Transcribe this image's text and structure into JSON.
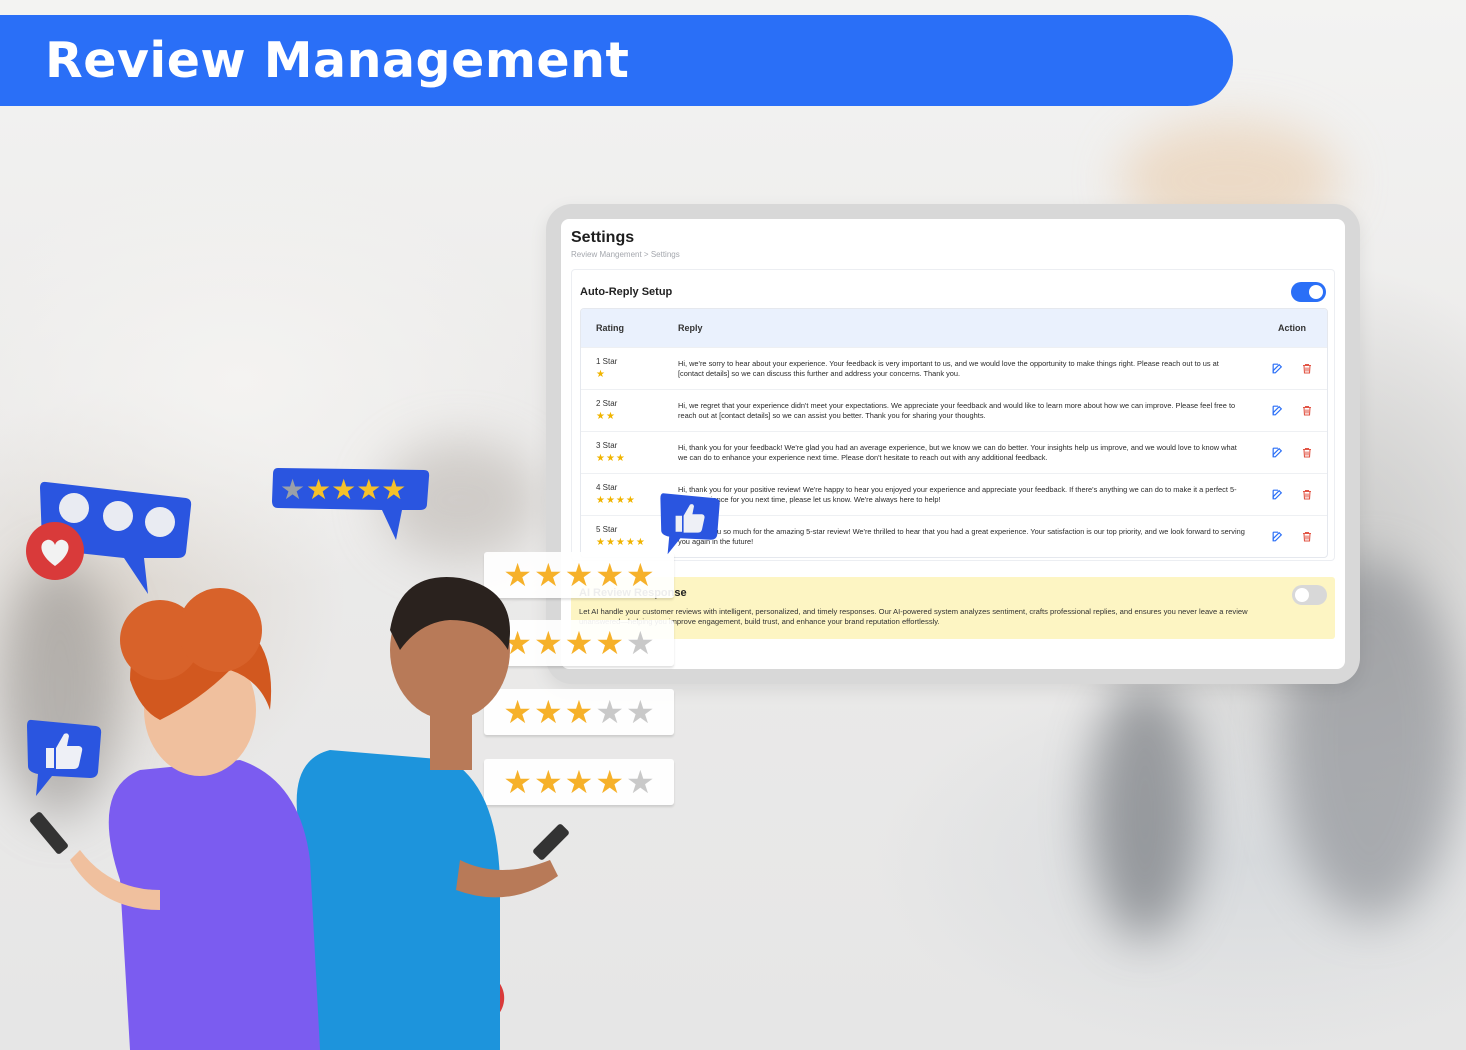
{
  "banner": {
    "title": "Review Management"
  },
  "settings": {
    "title": "Settings",
    "breadcrumb": "Review Mangement > Settings"
  },
  "auto_reply": {
    "title": "Auto-Reply Setup",
    "enabled": true,
    "columns": {
      "rating": "Rating",
      "reply": "Reply",
      "action": "Action"
    },
    "rows": [
      {
        "rating_label": "1 Star",
        "stars": "★",
        "reply": "Hi, we're sorry to hear about your experience. Your feedback is very important to us, and we would love the opportunity to make things right. Please reach out to us at [contact details] so we can discuss this further and address your concerns. Thank you."
      },
      {
        "rating_label": "2 Star",
        "stars": "★★",
        "reply": "Hi, we regret that your experience didn't meet your expectations. We appreciate your feedback and would like to learn more about how we can improve. Please feel free to reach out at [contact details] so we can assist you better. Thank you for sharing your thoughts."
      },
      {
        "rating_label": "3 Star",
        "stars": "★★★",
        "reply": "Hi, thank you for your feedback! We're glad you had an average experience, but we know we can do better. Your insights help us improve, and we would love to know what we can do to enhance your experience next time. Please don't hesitate to reach out with any additional feedback."
      },
      {
        "rating_label": "4 Star",
        "stars": "★★★★",
        "reply": "Hi, thank you for your positive review! We're happy to hear you enjoyed your experience and appreciate your feedback. If there's anything we can do to make it a perfect 5-star experience for you next time, please let us know. We're always here to help!"
      },
      {
        "rating_label": "5 Star",
        "stars": "★★★★★",
        "reply": "Hi, thank you so much for the amazing 5-star review! We're thrilled to hear that you had a great experience. Your satisfaction is our top priority, and we look forward to serving you again in the future!"
      }
    ]
  },
  "ai_review": {
    "title": "AI Review Response",
    "enabled": false,
    "description": "Let AI handle your customer reviews with intelligent, personalized, and timely responses. Our AI-powered system analyzes sentiment, crafts professional replies, and ensures you never leave a review unanswered—helping you improve engagement, build trust, and enhance your brand reputation effortlessly."
  },
  "decor": {
    "rating_strips": [
      5,
      4,
      3,
      4
    ],
    "bubble_rating": 4,
    "icons": [
      "chat-bubble-icon",
      "heart-icon",
      "thumbs-up-icon",
      "star-rating-bubble-icon"
    ]
  },
  "colors": {
    "brand_blue": "#2a6ff7",
    "star_gold": "#f0b400",
    "ai_box": "#fdf5c3",
    "edit_icon": "#2a6ff7",
    "delete_icon": "#e25545"
  }
}
